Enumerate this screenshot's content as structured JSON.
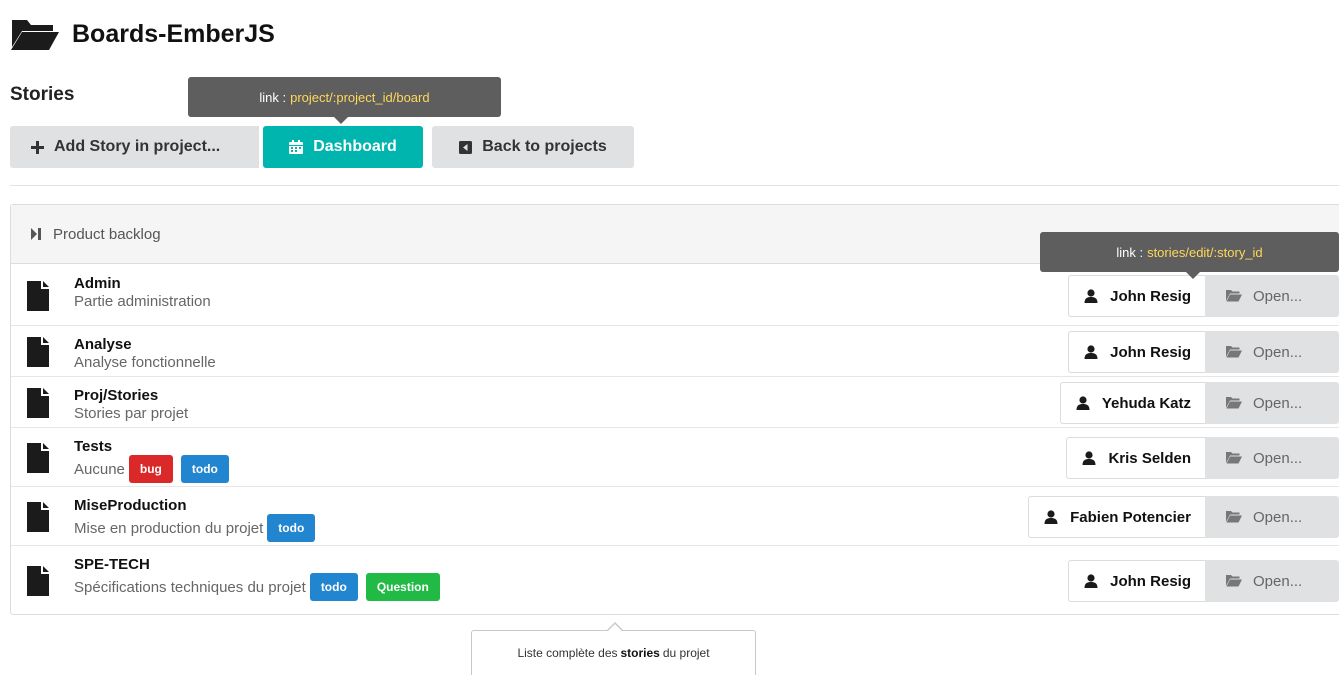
{
  "header": {
    "title": "Boards-EmberJS",
    "icon": "folder-open-icon"
  },
  "section": {
    "title": "Stories"
  },
  "toolbar": {
    "add_label": "Add Story in project...",
    "dashboard_label": "Dashboard",
    "back_label": "Back to projects"
  },
  "tooltips": {
    "dashboard": {
      "prefix": "link :",
      "path": "project/:project_id/board"
    },
    "edit": {
      "prefix": "link :",
      "path": "stories/edit/:story_id"
    }
  },
  "backlog": {
    "title": "Product backlog",
    "open_label": "Open...",
    "stories": [
      {
        "name": "Admin",
        "description": "Partie administration",
        "user": "John Resig",
        "labels": []
      },
      {
        "name": "Analyse",
        "description": "Analyse fonctionnelle",
        "user": "John Resig",
        "labels": []
      },
      {
        "name": "Proj/Stories",
        "description": "Stories par projet",
        "user": "Yehuda Katz",
        "labels": []
      },
      {
        "name": "Tests",
        "description": "Aucune",
        "user": "Kris Selden",
        "labels": [
          "bug",
          "todo"
        ]
      },
      {
        "name": "MiseProduction",
        "description": "Mise en production du projet",
        "user": "Fabien Potencier",
        "labels": [
          "todo"
        ]
      },
      {
        "name": "SPE-TECH",
        "description": "Spécifications techniques du projet",
        "user": "John Resig",
        "labels": [
          "todo",
          "Question"
        ]
      }
    ]
  },
  "footer_tip": {
    "before": "Liste complète des",
    "bold": "stories",
    "after": "du projet"
  },
  "colors": {
    "primary": "#00b5ad",
    "bug": "#db2828",
    "todo": "#2185d0",
    "question": "#21ba45",
    "link": "#ffd75a"
  }
}
